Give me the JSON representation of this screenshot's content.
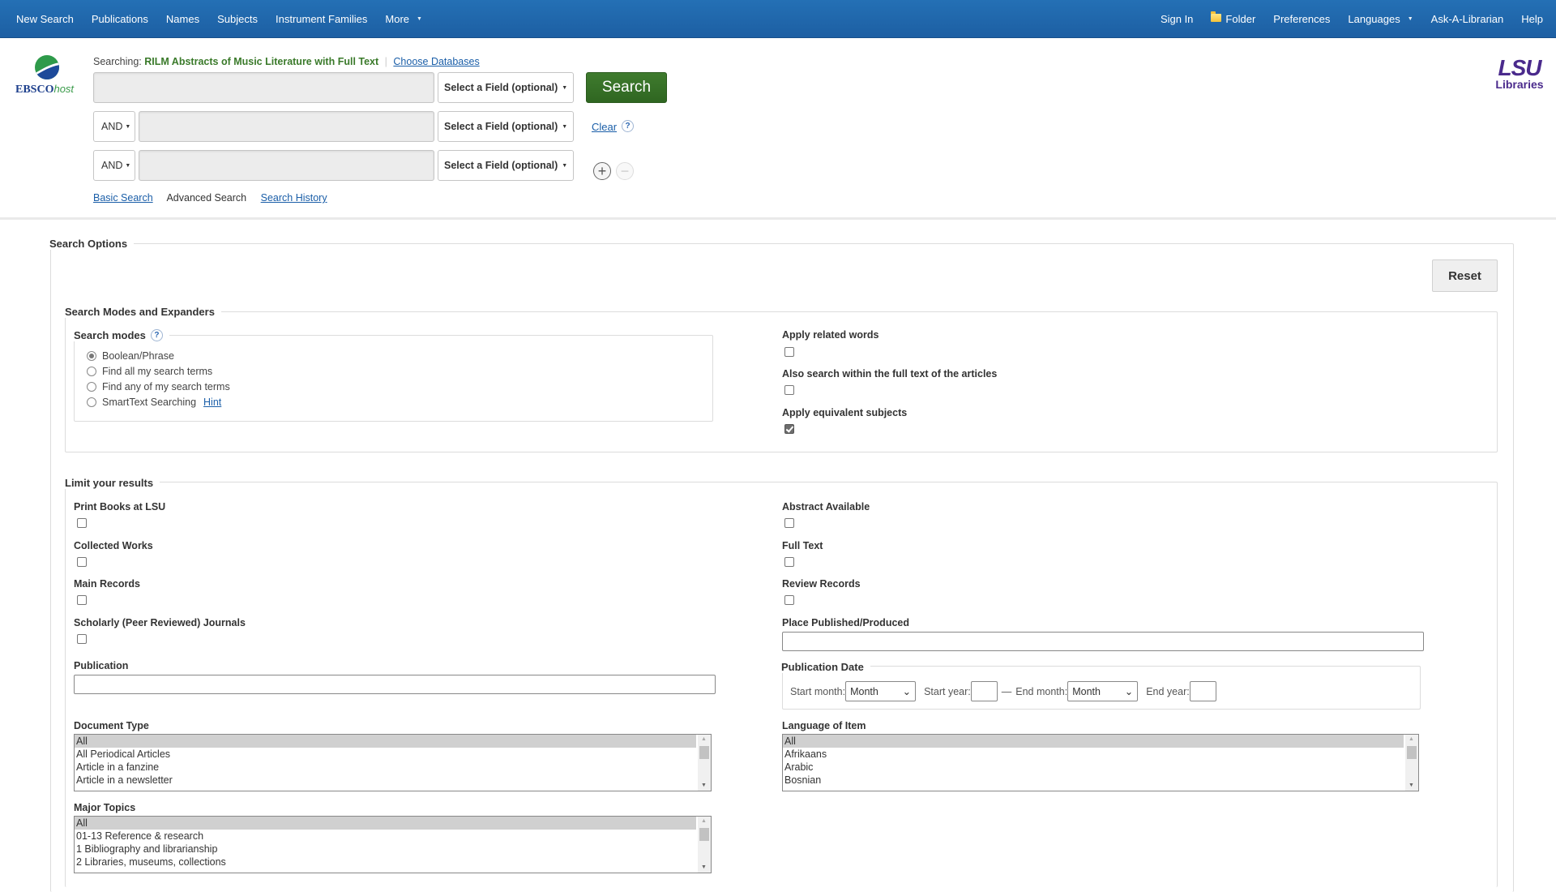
{
  "topnav": {
    "left": [
      {
        "label": "New Search"
      },
      {
        "label": "Publications"
      },
      {
        "label": "Names"
      },
      {
        "label": "Subjects"
      },
      {
        "label": "Instrument Families"
      },
      {
        "label": "More",
        "has_dropdown": true
      }
    ],
    "right": [
      {
        "label": "Sign In"
      },
      {
        "label": "Folder",
        "icon": "folder-icon"
      },
      {
        "label": "Preferences"
      },
      {
        "label": "Languages",
        "has_dropdown": true
      },
      {
        "label": "Ask-A-Librarian"
      },
      {
        "label": "Help"
      }
    ]
  },
  "brand": {
    "logo_main": "EBSCO",
    "logo_suffix": "host",
    "partner_logo_top": "LSU",
    "partner_logo_bottom": "Libraries"
  },
  "search": {
    "searching_label": "Searching:",
    "database": "RILM Abstracts of Music Literature with Full Text",
    "choose_databases": "Choose Databases",
    "rows": [
      {
        "bool": null,
        "value": "",
        "field": "Select a Field (optional)"
      },
      {
        "bool": "AND",
        "value": "",
        "field": "Select a Field (optional)"
      },
      {
        "bool": "AND",
        "value": "",
        "field": "Select a Field (optional)"
      }
    ],
    "search_button": "Search",
    "clear_link": "Clear",
    "help_glyph": "?",
    "add_row": "+",
    "remove_row": "−",
    "links": {
      "basic": "Basic Search",
      "advanced": "Advanced Search",
      "history": "Search History"
    }
  },
  "options": {
    "title": "Search Options",
    "reset": "Reset",
    "modes_section": {
      "title": "Search Modes and Expanders",
      "modes_label": "Search modes",
      "modes": [
        {
          "label": "Boolean/Phrase",
          "checked": true
        },
        {
          "label": "Find all my search terms",
          "checked": false
        },
        {
          "label": "Find any of my search terms",
          "checked": false
        },
        {
          "label": "SmartText Searching",
          "checked": false,
          "hint": "Hint"
        }
      ],
      "expanders": [
        {
          "label": "Apply related words",
          "checked": false
        },
        {
          "label": "Also search within the full text of the articles",
          "checked": false
        },
        {
          "label": "Apply equivalent subjects",
          "checked": true
        }
      ]
    },
    "limits": {
      "title": "Limit your results",
      "left_checks": [
        {
          "label": "Print Books at LSU",
          "checked": false
        },
        {
          "label": "Collected Works",
          "checked": false
        },
        {
          "label": "Main Records",
          "checked": false
        },
        {
          "label": "Scholarly (Peer Reviewed) Journals",
          "checked": false
        }
      ],
      "right_checks": [
        {
          "label": "Abstract Available",
          "checked": false
        },
        {
          "label": "Full Text",
          "checked": false
        },
        {
          "label": "Review Records",
          "checked": false
        }
      ],
      "publication": {
        "label": "Publication",
        "value": ""
      },
      "place": {
        "label": "Place Published/Produced",
        "value": ""
      },
      "pub_date": {
        "label": "Publication Date",
        "start_month_label": "Start month:",
        "start_month": "Month",
        "start_year_label": "Start year:",
        "start_year": "",
        "separator": "—",
        "end_month_label": "End month:",
        "end_month": "Month",
        "end_year_label": "End year:",
        "end_year": ""
      },
      "document_type": {
        "label": "Document Type",
        "options": [
          "All",
          "All Periodical Articles",
          "Article in a fanzine",
          "Article in a newsletter"
        ],
        "selected": "All"
      },
      "language": {
        "label": "Language of Item",
        "options": [
          "All",
          "Afrikaans",
          "Arabic",
          "Bosnian"
        ],
        "selected": "All"
      },
      "major_topics": {
        "label": "Major Topics",
        "options": [
          "All",
          "01-13 Reference & research",
          "1 Bibliography and librarianship",
          "2 Libraries, museums, collections"
        ],
        "selected": "All"
      }
    }
  }
}
